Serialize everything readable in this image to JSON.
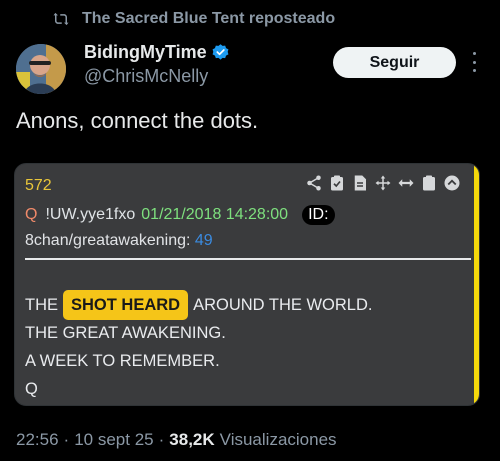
{
  "repost": {
    "text": "The Sacred Blue Tent reposteado"
  },
  "author": {
    "name": "BidingMyTime",
    "handle": "@ChrisMcNelly",
    "verified": true
  },
  "follow_button": "Seguir",
  "tweet": {
    "text": "Anons, connect the dots."
  },
  "drop": {
    "number": "572",
    "q": "Q",
    "trip": "!UW.yye1fxo",
    "datetime": "01/21/2018 14:28:00",
    "id_label": "ID:",
    "board": "8chan/greatawakening:",
    "board_count": "49",
    "body": {
      "line1_pre": "THE",
      "line1_highlight": "SHOT HEARD",
      "line1_post": "AROUND THE WORLD.",
      "line2": "THE GREAT AWAKENING.",
      "line3": "A WEEK TO REMEMBER.",
      "line4": "Q"
    },
    "tools": [
      "share-icon",
      "clipboard-check-icon",
      "document-icon",
      "move-icon",
      "resize-horizontal-icon",
      "clipboard-icon",
      "collapse-icon"
    ]
  },
  "footer": {
    "time": "22:56",
    "date": "10 sept 25",
    "views_count": "38,2K",
    "views_label": "Visualizaciones"
  },
  "colors": {
    "background": "#000000",
    "card": "#3a3b3d",
    "accent_yellow": "#f5d80b",
    "date_green": "#7ee07e",
    "count_blue": "#3b8be0",
    "verified_blue": "#1d9bf0"
  }
}
